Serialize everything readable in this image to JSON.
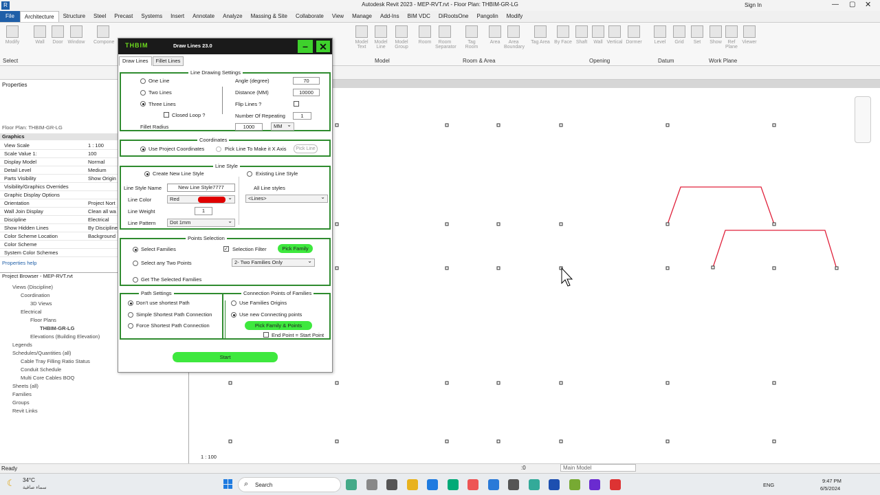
{
  "window": {
    "title": "Autodesk Revit 2023 - MEP-RVT.rvt - Floor Plan: THBIM-GR-LG",
    "sign_in": "Sign In"
  },
  "ribbon_tabs": [
    "File",
    "Architecture",
    "Structure",
    "Steel",
    "Precast",
    "Systems",
    "Insert",
    "Annotate",
    "Analyze",
    "Massing & Site",
    "Collaborate",
    "View",
    "Manage",
    "Add-Ins",
    "BIM VDC",
    "DiRootsOne",
    "Pangolin",
    "Modify"
  ],
  "ribbon_buttons": [
    "Modify",
    "Wall",
    "Door",
    "Window",
    "Compone",
    "Model Text",
    "Model Line",
    "Model Group",
    "Room",
    "Room Separator",
    "Tag Room",
    "Area",
    "Area Boundary",
    "Tag Area",
    "By Face",
    "Shaft",
    "Wall",
    "Vertical",
    "Dormer",
    "Level",
    "Grid",
    "Set",
    "Show",
    "Ref Plane",
    "Viewer"
  ],
  "ribbon_groups": [
    "Select",
    "Model",
    "Room & Area",
    "Opening",
    "Datum",
    "Work Plane"
  ],
  "properties": {
    "header": "Properties",
    "view_name": "Floor Plan: THBIM-GR-LG",
    "section": "Graphics",
    "rows": [
      [
        "View Scale",
        "1 : 100"
      ],
      [
        "Scale Value    1:",
        "100"
      ],
      [
        "Display Model",
        "Normal"
      ],
      [
        "Detail Level",
        "Medium"
      ],
      [
        "Parts Visibility",
        "Show Origin"
      ],
      [
        "Visibility/Graphics Overrides",
        ""
      ],
      [
        "Graphic Display Options",
        ""
      ],
      [
        "Orientation",
        "Project Nort"
      ],
      [
        "Wall Join Display",
        "Clean all wa"
      ],
      [
        "Discipline",
        "Electrical"
      ],
      [
        "Show Hidden Lines",
        "By Discipline"
      ],
      [
        "Color Scheme Location",
        "Background"
      ],
      [
        "Color Scheme",
        ""
      ],
      [
        "System Color Schemes",
        ""
      ]
    ],
    "help": "Properties help"
  },
  "project_browser": {
    "title": "Project Browser - MEP-RVT.rvt",
    "items": [
      "Views (Discipline)",
      "Coordination",
      "3D Views",
      "Electrical",
      "Floor Plans",
      "THBIM-GR-LG",
      "Elevations (Building Elevation)",
      "Legends",
      "Schedules/Quantities (all)",
      "Cable Tray Filling Ratio Status",
      "Conduit Schedule",
      "Multi Core Cables BOQ",
      "Sheets (all)",
      "Families",
      "Groups",
      "Revit Links"
    ]
  },
  "dialog": {
    "logo": "THBIM",
    "title": "Draw Lines 23.0",
    "tabs": [
      "Draw Lines",
      "Fillet Lines"
    ],
    "line_drawing": {
      "title": "Line Drawing Settings",
      "opt1": "One Line",
      "opt2": "Two Lines",
      "opt3": "Three Lines",
      "closed_loop": "Closed Loop ?",
      "fillet_radius": "Fillet Radius",
      "fillet_value": "1000",
      "unit": "MM",
      "angle_label": "Angle (degree)",
      "angle": "70",
      "distance_label": "Distance (MM)",
      "distance": "10000",
      "flip_label": "Flip Lines ?",
      "repeat_label": "Number Of Repeating",
      "repeat": "1"
    },
    "coordinates": {
      "title": "Coordinates",
      "opt1": "Use Project Coordinates",
      "opt2": "Pick Line To Make it X Axis",
      "pick_line": "Pick Line"
    },
    "line_style": {
      "title": "Line Style",
      "create": "Create New Line Style",
      "existing": "Existing Line Style",
      "name_label": "Line Style Name",
      "name": "New Line Style7777",
      "color_label": "Line Color",
      "color": "Red",
      "color_hex": "#e00000",
      "weight_label": "Line Weight",
      "weight": "1",
      "pattern_label": "Line Pattern",
      "pattern": "Dot 1mm",
      "all_styles": "All Line styles",
      "styles_value": "<Lines>"
    },
    "points": {
      "title": "Points Selection",
      "opt1": "Select Families",
      "opt2": "Select any Two Points",
      "opt3": "Get The Selected Families",
      "filter": "Selection Filter",
      "pick_family": "Pick Family",
      "filter_value": "2- Two Families Only"
    },
    "path": {
      "title": "Path Settings",
      "opt1": "Don't use shortest Path",
      "opt2": "Simple Shortest Path Connection",
      "opt3": "Force Shortest Path Connection"
    },
    "connection": {
      "title": "Connection Points of Families",
      "opt1": "Use Families Origins",
      "opt2": "Use new Connecting points",
      "pick": "Pick Family & Points",
      "end_eq_start": "End Point = Start Point"
    },
    "start": "Start"
  },
  "status": {
    "left": "Ready",
    "scale": "1 : 100",
    "model": "Main Model",
    "zero": ":0"
  },
  "taskbar": {
    "weather_temp": "34°C",
    "weather_desc": "سماء صافية",
    "search": "Search",
    "lang": "ENG",
    "time": "9:47 PM",
    "date": "6/5/2024"
  },
  "colors": {
    "accent_green": "#3ee83e",
    "box_green": "#2e8b2e",
    "line_red": "#e0203a"
  }
}
